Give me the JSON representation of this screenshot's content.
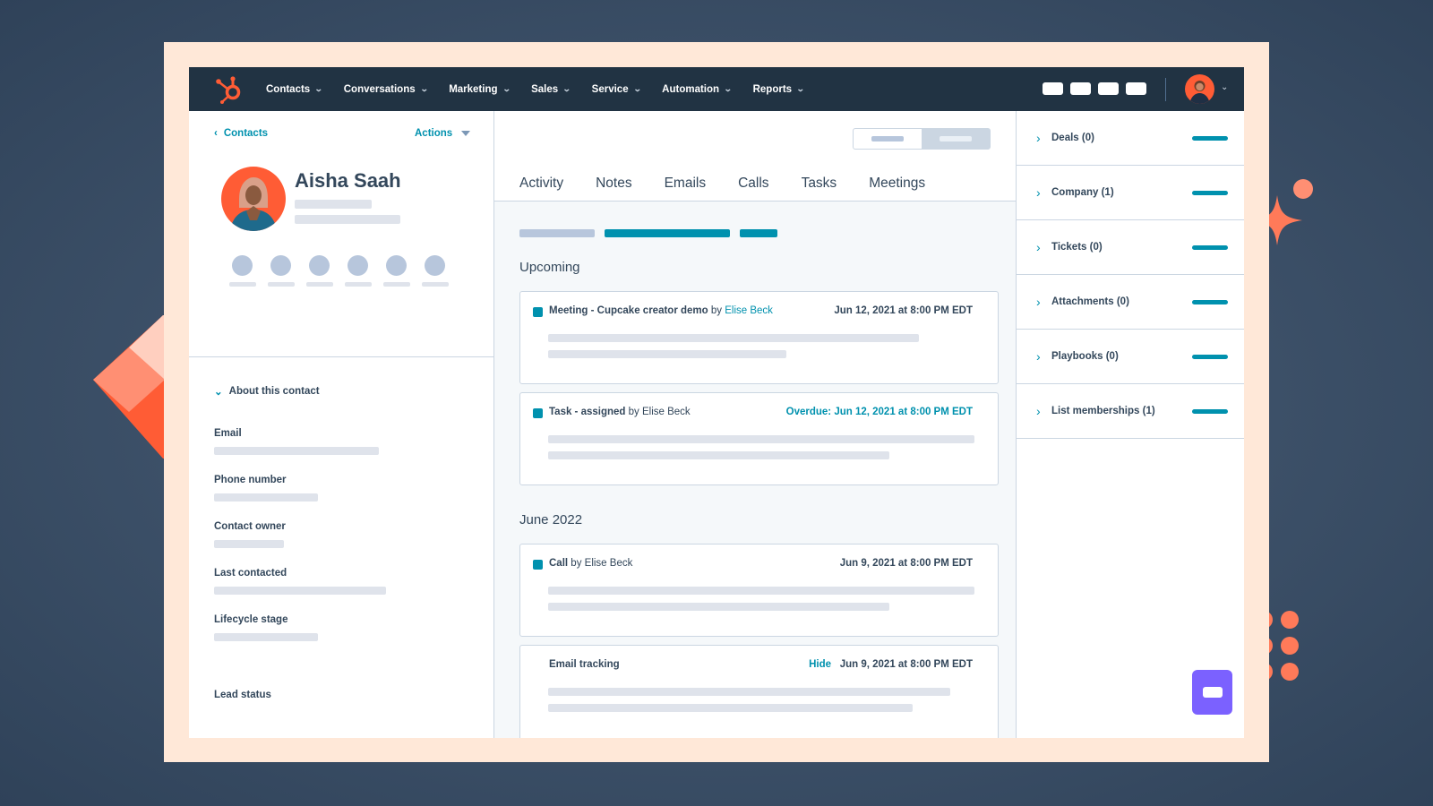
{
  "nav": {
    "items": [
      {
        "label": "Contacts"
      },
      {
        "label": "Conversations"
      },
      {
        "label": "Marketing"
      },
      {
        "label": "Sales"
      },
      {
        "label": "Service"
      },
      {
        "label": "Automation"
      },
      {
        "label": "Reports"
      }
    ]
  },
  "contact": {
    "back_label": "Contacts",
    "actions_label": "Actions",
    "name": "Aisha Saah",
    "about_label": "About this contact",
    "fields": [
      {
        "label": "Email"
      },
      {
        "label": "Phone number"
      },
      {
        "label": "Contact owner"
      },
      {
        "label": "Last contacted"
      },
      {
        "label": "Lifecycle stage"
      },
      {
        "label": "Lead status"
      }
    ]
  },
  "tabs": [
    "Activity",
    "Notes",
    "Emails",
    "Calls",
    "Tasks",
    "Meetings"
  ],
  "timeline": {
    "upcoming_title": "Upcoming",
    "month_title": "June 2022",
    "cards": [
      {
        "type": "Meeting - Cupcake creator demo",
        "by": "by",
        "person": "Elise Beck",
        "date": "Jun 12, 2021 at 8:00 PM EDT"
      },
      {
        "type": "Task - assigned",
        "by": "by",
        "person": "Elise Beck",
        "date": "Overdue: Jun 12, 2021 at 8:00 PM EDT"
      },
      {
        "type": "Call",
        "by": "by",
        "person": "Elise Beck",
        "date": "Jun 9, 2021 at 8:00 PM EDT"
      },
      {
        "type": "Email tracking",
        "hide": "Hide",
        "date": "Jun 9, 2021 at 8:00 PM EDT"
      }
    ]
  },
  "sidebar": {
    "items": [
      {
        "label": "Deals (0)"
      },
      {
        "label": "Company (1)"
      },
      {
        "label": "Tickets (0)"
      },
      {
        "label": "Attachments (0)"
      },
      {
        "label": "Playbooks (0)"
      },
      {
        "label": "List memberships (1)"
      }
    ]
  },
  "colors": {
    "accent": "#0091ae",
    "nav_bg": "#213343",
    "brand_orange": "#ff5c35"
  }
}
